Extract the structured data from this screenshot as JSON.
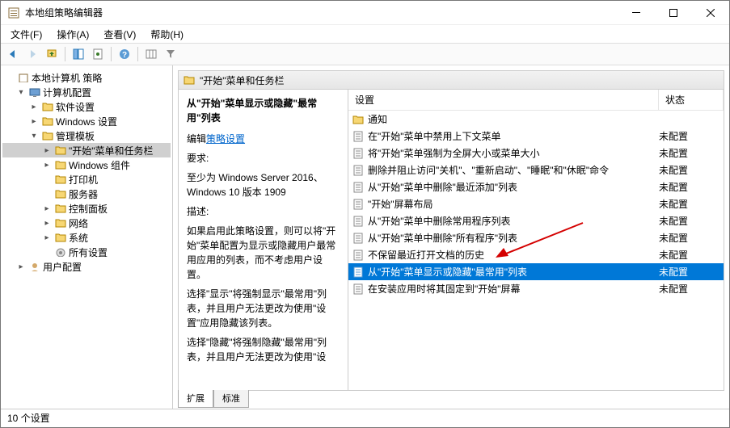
{
  "window": {
    "title": "本地组策略编辑器"
  },
  "menu": {
    "file": "文件(F)",
    "action": "操作(A)",
    "view": "查看(V)",
    "help": "帮助(H)"
  },
  "tree": {
    "root": "本地计算机 策略",
    "computer": "计算机配置",
    "software": "软件设置",
    "windows": "Windows 设置",
    "admin": "管理模板",
    "start_taskbar": "\"开始\"菜单和任务栏",
    "win_components": "Windows 组件",
    "printers": "打印机",
    "servers": "服务器",
    "control_panel": "控制面板",
    "network": "网络",
    "system": "系统",
    "all_settings": "所有设置",
    "user": "用户配置"
  },
  "header": {
    "title": "\"开始\"菜单和任务栏"
  },
  "desc": {
    "title": "从\"开始\"菜单显示或隐藏\"最常用\"列表",
    "edit_label": "编辑",
    "edit_link": "策略设置",
    "req_label": "要求:",
    "req_text": "至少为 Windows Server 2016、Windows 10 版本 1909",
    "d_label": "描述:",
    "d1": "如果启用此策略设置，则可以将\"开始\"菜单配置为显示或隐藏用户最常用应用的列表，而不考虑用户设置。",
    "d2": "选择\"显示\"将强制显示\"最常用\"列表，并且用户无法更改为使用\"设置\"应用隐藏该列表。",
    "d3": "选择\"隐藏\"将强制隐藏\"最常用\"列表，并且用户无法更改为使用\"设"
  },
  "columns": {
    "setting": "设置",
    "state": "状态"
  },
  "rows": {
    "group": "通知",
    "r0": {
      "n": "在\"开始\"菜单中禁用上下文菜单",
      "s": "未配置"
    },
    "r1": {
      "n": "将\"开始\"菜单强制为全屏大小或菜单大小",
      "s": "未配置"
    },
    "r2": {
      "n": "删除并阻止访问\"关机\"、\"重新启动\"、\"睡眠\"和\"休眠\"命令",
      "s": "未配置"
    },
    "r3": {
      "n": "从\"开始\"菜单中删除\"最近添加\"列表",
      "s": "未配置"
    },
    "r4": {
      "n": "\"开始\"屏幕布局",
      "s": "未配置"
    },
    "r5": {
      "n": "从\"开始\"菜单中删除常用程序列表",
      "s": "未配置"
    },
    "r6": {
      "n": "从\"开始\"菜单中删除\"所有程序\"列表",
      "s": "未配置"
    },
    "r7": {
      "n": "不保留最近打开文档的历史",
      "s": "未配置"
    },
    "r8": {
      "n": "从\"开始\"菜单显示或隐藏\"最常用\"列表",
      "s": "未配置"
    },
    "r9": {
      "n": "在安装应用时将其固定到\"开始\"屏幕",
      "s": "未配置"
    }
  },
  "tabs": {
    "extended": "扩展",
    "standard": "标准"
  },
  "status": {
    "text": "10 个设置"
  }
}
